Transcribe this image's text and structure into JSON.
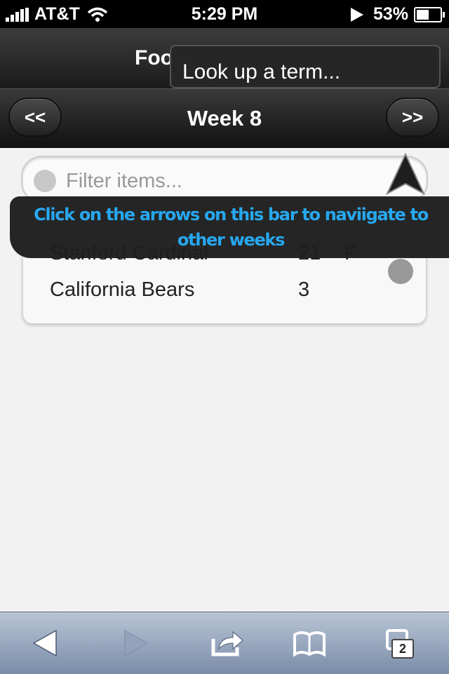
{
  "status_bar": {
    "carrier": "AT&T",
    "time": "5:29 PM",
    "battery": "53%",
    "battery_level": 0.53
  },
  "header": {
    "title": "Foo",
    "lookup_placeholder": "Look up a term..."
  },
  "week_nav": {
    "prev_label": "<<",
    "title": "Week 8",
    "next_label": ">>"
  },
  "filter": {
    "placeholder": "Filter items..."
  },
  "games": [
    {
      "team": "Stanford Cardinal",
      "score": "21",
      "status": "F"
    },
    {
      "team": "California Bears",
      "score": "3",
      "status": ""
    }
  ],
  "tooltip": {
    "text": "Click on the arrows on this bar to naviigate to other weeks"
  },
  "toolbar": {
    "tabs_count": "2"
  },
  "icons": [
    "signal-icon",
    "wifi-icon",
    "location-icon",
    "battery-icon",
    "back-icon",
    "forward-icon",
    "share-icon",
    "bookmarks-icon",
    "pages-icon",
    "pointer-arrow-icon"
  ],
  "colors": {
    "tooltip_text": "#26a8f0",
    "toolbar": "#a2b1c6"
  }
}
